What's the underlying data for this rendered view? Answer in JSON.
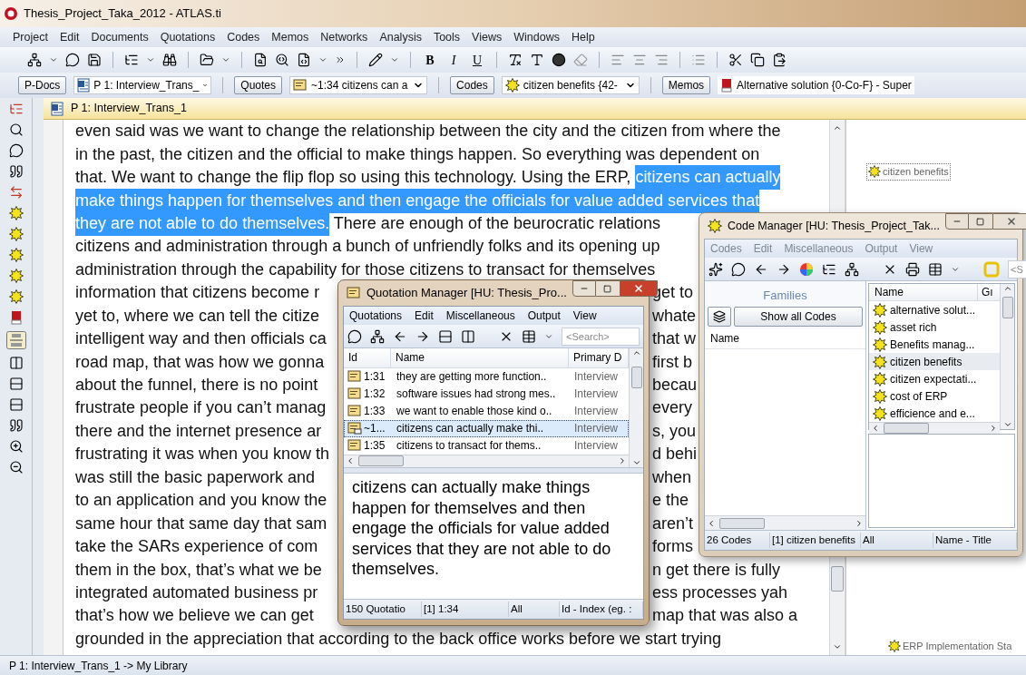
{
  "window": {
    "title": "Thesis_Project_Taka_2012 - ATLAS.ti"
  },
  "menu": [
    "Project",
    "Edit",
    "Documents",
    "Quotations",
    "Codes",
    "Memos",
    "Networks",
    "Analysis",
    "Tools",
    "Views",
    "Windows",
    "Help"
  ],
  "format_buttons": [
    "B",
    "I",
    "U"
  ],
  "selectors": [
    {
      "button": "P-Docs",
      "kind": "document",
      "value": "P 1: Interview_Trans_",
      "dropdown": true
    },
    {
      "button": "Quotes",
      "kind": "quotation",
      "value": "~1:34 citizens can a",
      "dropdown": true
    },
    {
      "button": "Codes",
      "kind": "code",
      "value": "citizen benefits {42-",
      "dropdown": true
    },
    {
      "button": "Memos",
      "kind": "memo",
      "value": "Alternative solution {0-Co-F} - Super",
      "dropdown": false
    }
  ],
  "document": {
    "tab": "P 1: Interview_Trans_1",
    "lines": [
      {
        "segments": [
          {
            "text": "even said was we want to change the relationship between the city and the citizen from where the",
            "highlighted": false
          }
        ]
      },
      {
        "segments": [
          {
            "text": "in the past, the citizen and the official to make things happen. So everything was dependent on",
            "highlighted": false
          }
        ]
      },
      {
        "segments": [
          {
            "text": "that. We want to change the flip flop so using this technology. Using the ERP, ",
            "highlighted": false
          },
          {
            "text": "citizens can actually",
            "highlighted": true
          }
        ]
      },
      {
        "segments": [
          {
            "text": "make things happen for themselves and then engage the officials for value added services that",
            "highlighted": true
          }
        ]
      },
      {
        "segments": [
          {
            "text": "they are not able to do themselves.",
            "highlighted": true
          },
          {
            "text": " There are enough of the beurocratic relations",
            "highlighted": false
          }
        ]
      },
      {
        "segments": [
          {
            "text": "citizens and administration through a bunch of unfriendly folks and its opening up",
            "highlighted": false
          }
        ]
      },
      {
        "segments": [
          {
            "text": "administration through the capability for those citizens to transact for themselves",
            "highlighted": false
          }
        ]
      },
      {
        "segments": [
          {
            "text": "information that citizens become r",
            "highlighted": false
          }
        ],
        "right": "get to"
      },
      {
        "segments": [
          {
            "text": "yet to, where we can tell the citize",
            "highlighted": false
          }
        ],
        "right": "whate"
      },
      {
        "segments": [
          {
            "text": "intelligent way and then officials ca",
            "highlighted": false
          }
        ],
        "right": "that w"
      },
      {
        "segments": [
          {
            "text": "road map, that was how we gonna",
            "highlighted": false
          }
        ],
        "right": "first b"
      },
      {
        "segments": [
          {
            "text": "about the funnel, there is no point",
            "highlighted": false
          }
        ],
        "right": "becau"
      },
      {
        "segments": [
          {
            "text": "frustrate people if you can’t manag",
            "highlighted": false
          }
        ],
        "right": "every"
      },
      {
        "segments": [
          {
            "text": "there and the internet presence ar",
            "highlighted": false
          }
        ],
        "right": "s, you"
      },
      {
        "segments": [
          {
            "text": "frustrating it was when you know th",
            "highlighted": false
          }
        ],
        "right": "d behi"
      },
      {
        "segments": [
          {
            "text": "was still the basic paperwork and",
            "highlighted": false
          }
        ],
        "right": "when"
      },
      {
        "segments": [
          {
            "text": "to an application and you know the",
            "highlighted": false
          }
        ],
        "right": "e the"
      },
      {
        "segments": [
          {
            "text": "same hour that same day that sam",
            "highlighted": false
          }
        ],
        "right": "aren’t"
      },
      {
        "segments": [
          {
            "text": "take the SARs experience of com",
            "highlighted": false
          }
        ],
        "right": "forms"
      },
      {
        "segments": [
          {
            "text": "them in the box, that’s what we be",
            "highlighted": false
          }
        ],
        "right": "n get there is fully"
      },
      {
        "segments": [
          {
            "text": "integrated automated business pr",
            "highlighted": false
          }
        ],
        "right": "ess processes yah"
      },
      {
        "segments": [
          {
            "text": "that’s how we believe we can get",
            "highlighted": false
          }
        ],
        "right": "map that was also a"
      },
      {
        "segments": [
          {
            "text": "grounded in the appreciation that according to the back office works before we start trying",
            "highlighted": false
          }
        ]
      }
    ],
    "margin_codes": [
      "citizen benefits",
      "ERP Implementation Sta"
    ]
  },
  "status_bar": "P 1: Interview_Trans_1 -> My Library",
  "quotation_manager": {
    "title": "Quotation Manager [HU: Thesis_Pro...",
    "active": true,
    "menu": [
      "Quotations",
      "Edit",
      "Miscellaneous",
      "Output",
      "View"
    ],
    "search": {
      "placeholder": "<Search>"
    },
    "columns": [
      "Id",
      "Name",
      "Primary D"
    ],
    "rows": [
      {
        "id": "1:31",
        "name": "they are getting more function..",
        "primary": "Interview",
        "selected": false
      },
      {
        "id": "1:32",
        "name": "software issues had strong mes..",
        "primary": "Interview",
        "selected": false
      },
      {
        "id": "1:33",
        "name": "we want to enable those kind o..",
        "primary": "Interview",
        "selected": false
      },
      {
        "id": "~1...",
        "name": "citizens can actually make thi..",
        "primary": "Interview",
        "selected": true
      },
      {
        "id": "1:35",
        "name": "citizens to transact for thems..",
        "primary": "Interview",
        "selected": false
      }
    ],
    "text": "citizens can actually make things happen for themselves and then engage the officials for value added services that they are not able to do themselves.",
    "status": [
      "150 Quotatio",
      "[1] 1:34",
      "All",
      "Id - Index (eg. :"
    ]
  },
  "code_manager": {
    "title": "Code Manager [HU: Thesis_Project_Tak...",
    "active": false,
    "menu": [
      "Codes",
      "Edit",
      "Miscellaneous",
      "Output",
      "View"
    ],
    "search": {
      "placeholder": "<S"
    },
    "families_heading": "Families",
    "show_all": "Show all Codes",
    "families_column": "Name",
    "columns": [
      "Name",
      "Gı"
    ],
    "codes": [
      {
        "name": "alternative solut...",
        "selected": false
      },
      {
        "name": "asset rich",
        "selected": false
      },
      {
        "name": "Benefits manag...",
        "selected": false
      },
      {
        "name": "citizen benefits",
        "selected": true
      },
      {
        "name": "citizen expectati...",
        "selected": false
      },
      {
        "name": "cost of ERP",
        "selected": false
      },
      {
        "name": "efficience and e...",
        "selected": false
      }
    ],
    "status": [
      "26 Codes",
      "[1] citizen benefits",
      "All",
      "Name - Title"
    ]
  }
}
